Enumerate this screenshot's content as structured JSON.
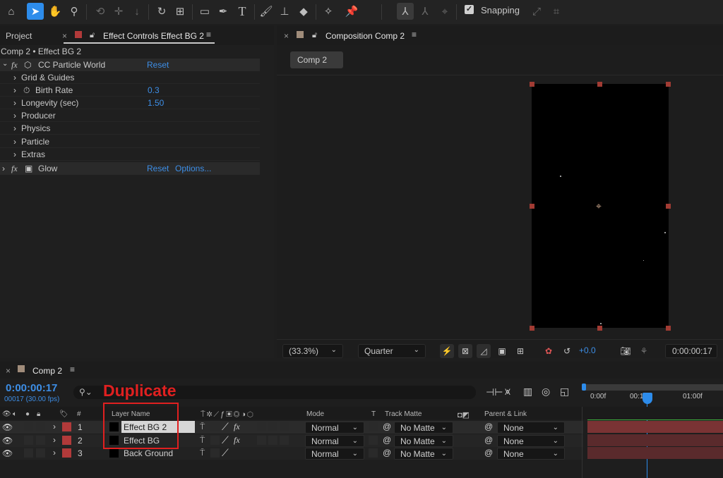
{
  "toolbar": {
    "icons": [
      "home-icon",
      "selection-tool-icon",
      "hand-tool-icon",
      "zoom-tool-icon",
      "orbit-camera-icon",
      "pan-camera-icon",
      "dolly-camera-icon",
      "rotate-tool-icon",
      "pan-behind-icon",
      "rectangle-tool-icon",
      "pen-tool-icon",
      "type-tool-icon",
      "brush-tool-icon",
      "clone-stamp-icon",
      "eraser-icon",
      "roto-brush-icon",
      "puppet-pin-icon"
    ],
    "snapping_label": "Snapping",
    "snapping_checked": true
  },
  "left_panel": {
    "tab_project": "Project",
    "tab_effect_controls": "Effect Controls Effect BG 2",
    "breadcrumb": "Comp 2 • Effect BG 2",
    "effects": [
      {
        "label": "CC Particle World",
        "reset": "Reset"
      },
      {
        "label": "Grid & Guides"
      },
      {
        "label": "Birth Rate",
        "value": "0.3"
      },
      {
        "label": "Longevity (sec)",
        "value": "1.50"
      },
      {
        "label": "Producer"
      },
      {
        "label": "Physics"
      },
      {
        "label": "Particle"
      },
      {
        "label": "Extras"
      },
      {
        "label": "Glow",
        "reset": "Reset",
        "options": "Options..."
      }
    ]
  },
  "comp_panel": {
    "tab_label": "Composition Comp 2",
    "comp_chip": "Comp 2",
    "zoom": "(33.3%)",
    "resolution": "Quarter",
    "exposure": "+0.0",
    "timecode": "0:00:00:17"
  },
  "timeline": {
    "tab_label": "Comp 2",
    "timecode": "0:00:00:17",
    "frame_info": "00017 (30.00 fps)",
    "annotation": "Duplicate",
    "headers": {
      "hash": "#",
      "layer_name": "Layer Name",
      "mode": "Mode",
      "t": "T",
      "track_matte": "Track Matte",
      "parent_link": "Parent & Link"
    },
    "ruler": [
      "0:00f",
      "00:15f",
      "01:00f"
    ],
    "layers": [
      {
        "num": "1",
        "name": "Effect BG 2",
        "mode": "Normal",
        "matte": "No Matte",
        "parent": "None",
        "fx": true,
        "selected": true
      },
      {
        "num": "2",
        "name": "Effect BG",
        "mode": "Normal",
        "matte": "No Matte",
        "parent": "None",
        "fx": true,
        "selected": false
      },
      {
        "num": "3",
        "name": "Back Ground",
        "mode": "Normal",
        "matte": "No Matte",
        "parent": "None",
        "fx": false,
        "selected": false
      }
    ]
  },
  "colors": {
    "accent": "#2d8ceb",
    "label_red": "#b23a3a",
    "annotation_red": "#e02020",
    "value_blue": "#3d8ee6"
  }
}
